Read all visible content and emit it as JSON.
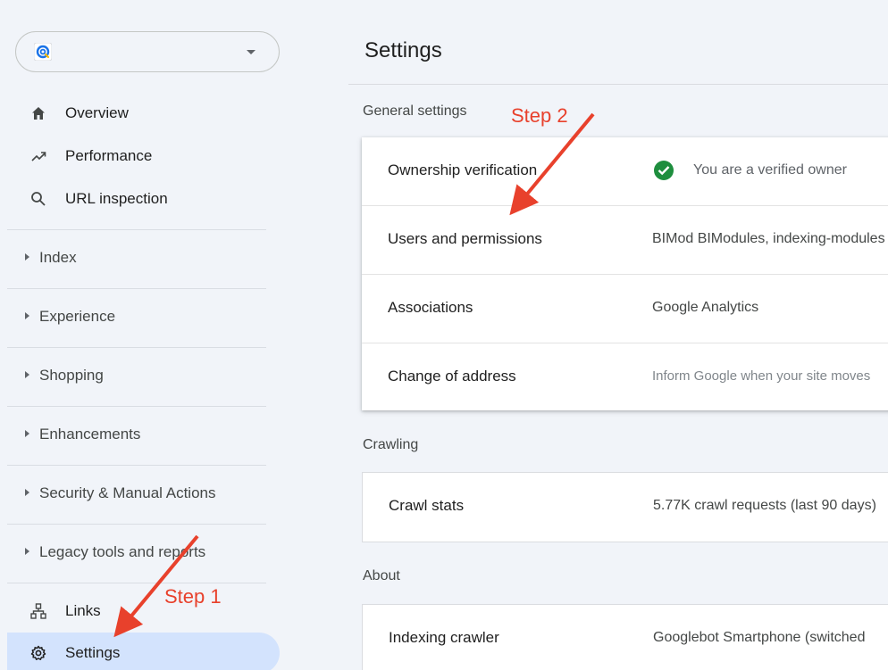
{
  "sidebar": {
    "top_items": [
      {
        "label": "Overview",
        "icon": "home-icon"
      },
      {
        "label": "Performance",
        "icon": "trending-up-icon"
      },
      {
        "label": "URL inspection",
        "icon": "search-icon"
      }
    ],
    "groups": [
      {
        "label": "Index"
      },
      {
        "label": "Experience"
      },
      {
        "label": "Shopping"
      },
      {
        "label": "Enhancements"
      },
      {
        "label": "Security & Manual Actions"
      },
      {
        "label": "Legacy tools and reports"
      }
    ],
    "bottom_items": [
      {
        "label": "Links",
        "icon": "sitemap-icon"
      },
      {
        "label": "Settings",
        "icon": "gear-icon",
        "active": true
      }
    ]
  },
  "main": {
    "title": "Settings",
    "general": {
      "label": "General settings",
      "rows": [
        {
          "label": "Ownership verification",
          "value": "You are a verified owner"
        },
        {
          "label": "Users and permissions",
          "value": "BIMod BIModules, indexing-modules"
        },
        {
          "label": "Associations",
          "value": "Google Analytics"
        },
        {
          "label": "Change of address",
          "value": "Inform Google when your site moves"
        }
      ]
    },
    "crawling": {
      "label": "Crawling",
      "rows": [
        {
          "label": "Crawl stats",
          "value": "5.77K crawl requests (last 90 days)"
        }
      ]
    },
    "about": {
      "label": "About",
      "rows": [
        {
          "label": "Indexing crawler",
          "value": "Googlebot Smartphone (switched"
        }
      ]
    }
  },
  "annotations": {
    "step1": "Step 1",
    "step2": "Step 2"
  },
  "colors": {
    "background": "#f1f4f9",
    "active_nav": "#d3e3fd",
    "verified_green": "#1e8e3e",
    "annotation_red": "#e8412c"
  }
}
